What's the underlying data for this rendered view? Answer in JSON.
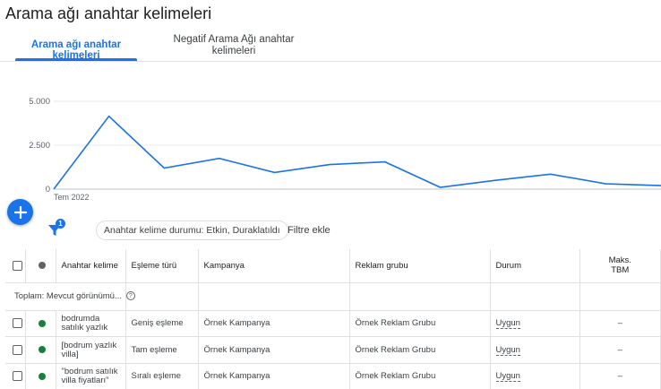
{
  "header": {
    "title": "Arama ağı anahtar kelimeleri"
  },
  "tabs": [
    {
      "label": "Arama ağı anahtar kelimeleri"
    },
    {
      "label": "Negatif Arama Ağı anahtar kelimeleri"
    }
  ],
  "chart_data": {
    "type": "line",
    "x_start_label": "Tem 2022",
    "y_ticks": [
      "5.000",
      "2.500",
      "0"
    ],
    "ylim": [
      0,
      5000
    ],
    "series": [
      {
        "values": [
          0,
          4150,
          1200,
          1750,
          950,
          1400,
          1550,
          100,
          500,
          850,
          300,
          200
        ]
      }
    ],
    "line_color": "#1a73e8"
  },
  "toolbar": {
    "add_icon": "plus-icon",
    "filter_icon": "filter-icon",
    "filter_badge": "1",
    "filter_chip_label": "Anahtar kelime durumu: Etkin, Duraklatıldı",
    "add_filter_label": "Filtre ekle"
  },
  "table": {
    "headers": {
      "keyword": "Anahtar kelime",
      "match_type": "Eşleme türü",
      "campaign": "Kampanya",
      "ad_group": "Reklam grubu",
      "status": "Durum",
      "max_cpc": "Maks. TBM"
    },
    "total_label": "Toplam: Mevcut görünümü...",
    "rows": [
      {
        "keyword": "bodrumda satılık yazlık",
        "match_type": "Geniş eşleme",
        "campaign": "Örnek Kampanya",
        "ad_group": "Örnek Reklam Grubu",
        "status": "Uygun",
        "max_cpc": "–",
        "status_color": "#188038"
      },
      {
        "keyword": "[bodrum yazlık villa]",
        "match_type": "Tam eşleme",
        "campaign": "Örnek Kampanya",
        "ad_group": "Örnek Reklam Grubu",
        "status": "Uygun",
        "max_cpc": "–",
        "status_color": "#188038"
      },
      {
        "keyword": "\"bodrum satılık villa fiyatları\"",
        "match_type": "Sıralı eşleme",
        "campaign": "Örnek Kampanya",
        "ad_group": "Örnek Reklam Grubu",
        "status": "Uygun",
        "max_cpc": "–",
        "status_color": "#188038"
      }
    ]
  }
}
